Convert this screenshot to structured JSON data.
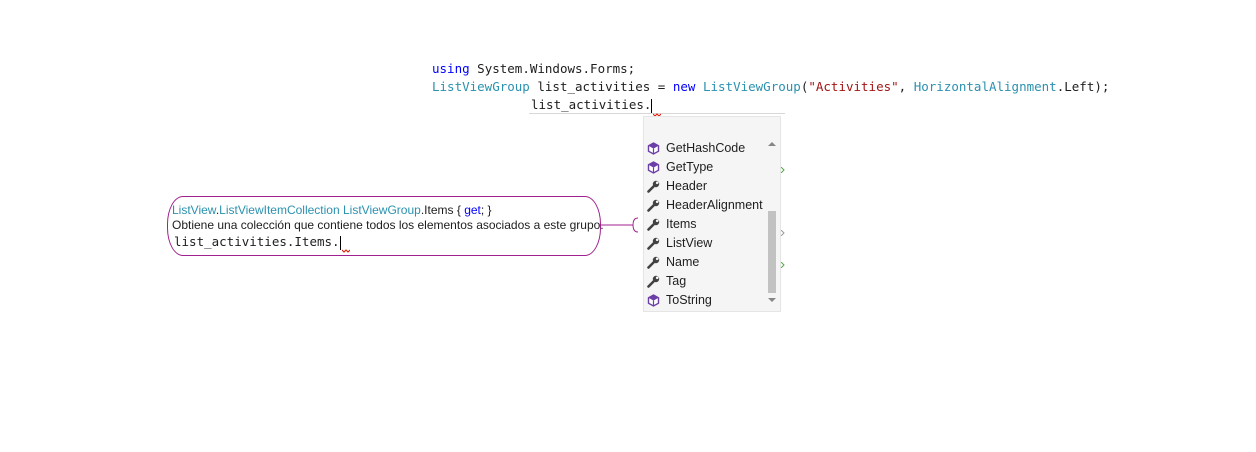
{
  "editor": {
    "line1": {
      "kw_using": "using",
      "namespace": "System.Windows.Forms;"
    },
    "line2": {
      "type1": "ListViewGroup",
      "var": "list_activities",
      "eq": "=",
      "kw_new": "new",
      "type2": "ListViewGroup",
      "paren_open": "(",
      "str": "\"Activities\"",
      "comma": ",",
      "type3": "HorizontalAlignment",
      "rest": ".Left);"
    },
    "line3": {
      "text": "list_activities."
    }
  },
  "completion": {
    "items": [
      {
        "label": "GetHashCode",
        "icon": "method-icon"
      },
      {
        "label": "GetType",
        "icon": "method-icon"
      },
      {
        "label": "Header",
        "icon": "property-icon"
      },
      {
        "label": "HeaderAlignment",
        "icon": "property-icon"
      },
      {
        "label": "Items",
        "icon": "property-icon"
      },
      {
        "label": "ListView",
        "icon": "property-icon"
      },
      {
        "label": "Name",
        "icon": "property-icon"
      },
      {
        "label": "Tag",
        "icon": "property-icon"
      },
      {
        "label": "ToString",
        "icon": "method-icon"
      }
    ],
    "scroll_position": 0.6
  },
  "tooltip": {
    "sig_type1": "ListView",
    "sig_dot1": ".",
    "sig_type2": "ListViewItemCollection",
    "sig_space": " ",
    "sig_type3": "ListViewGroup",
    "sig_member": ".Items { ",
    "sig_get": "get",
    "sig_end": "; }",
    "description": "Obtiene una colección que contiene todos los elementos asociados a este grupo.",
    "example": "list_activities.Items."
  },
  "colors": {
    "keyword": "#0000ff",
    "type": "#2b91af",
    "string": "#a31515",
    "highlight_border": "#a0208f",
    "method_icon": "#6c3fa8",
    "property_icon": "#424242"
  }
}
